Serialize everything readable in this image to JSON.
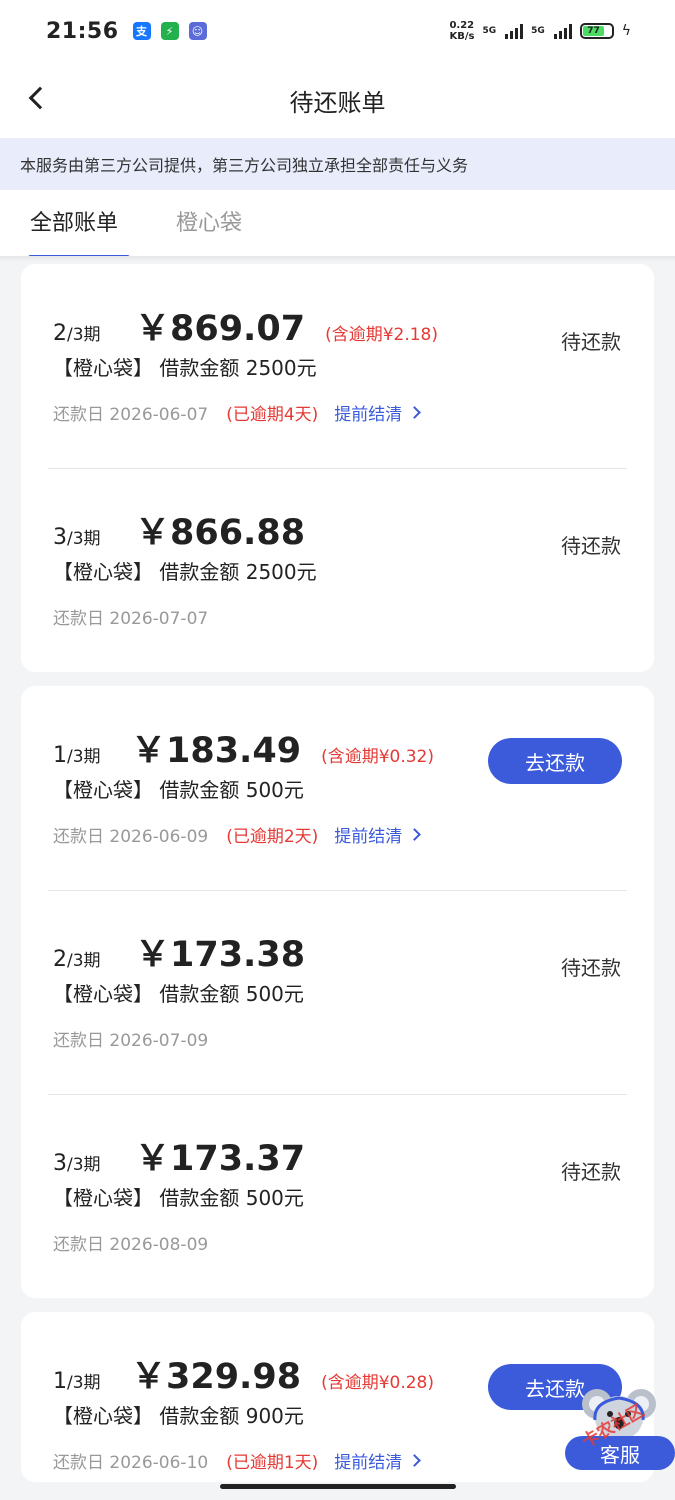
{
  "status_bar": {
    "time": "21:56",
    "network_speed": "0.22",
    "network_unit": "KB/s",
    "sim1": "5G",
    "sim2": "5G",
    "battery": "77"
  },
  "header": {
    "title": "待还账单",
    "back_icon": "chevron-left-icon"
  },
  "notice": "本服务由第三方公司提供，第三方公司独立承担全部责任与义务",
  "tabs": [
    {
      "label": "全部账单",
      "active": true
    },
    {
      "label": "橙心袋",
      "active": false
    }
  ],
  "labels": {
    "due_date_prefix": "还款日",
    "prepay": "提前结清",
    "pay_button": "去还款",
    "status_pending": "待还款"
  },
  "groups": [
    {
      "bills": [
        {
          "period_num": "2",
          "period_total": "/3期",
          "amount": "￥869.07",
          "overdue_amount": "(含逾期¥2.18)",
          "product_line": "【橙心袋】 借款金额 2500元",
          "due_date": "还款日 2026-06-07",
          "overdue_days": "(已逾期4天)",
          "prepay": "提前结清",
          "action": "待还款"
        },
        {
          "period_num": "3",
          "period_total": "/3期",
          "amount": "￥866.88",
          "overdue_amount": "",
          "product_line": "【橙心袋】 借款金额 2500元",
          "due_date": "还款日 2026-07-07",
          "overdue_days": "",
          "prepay": "",
          "action": "待还款"
        }
      ]
    },
    {
      "bills": [
        {
          "period_num": "1",
          "period_total": "/3期",
          "amount": "￥183.49",
          "overdue_amount": "(含逾期¥0.32)",
          "product_line": "【橙心袋】 借款金额 500元",
          "due_date": "还款日 2026-06-09",
          "overdue_days": "(已逾期2天)",
          "prepay": "提前结清",
          "action": "去还款"
        },
        {
          "period_num": "2",
          "period_total": "/3期",
          "amount": "￥173.38",
          "overdue_amount": "",
          "product_line": "【橙心袋】 借款金额 500元",
          "due_date": "还款日 2026-07-09",
          "overdue_days": "",
          "prepay": "",
          "action": "待还款"
        },
        {
          "period_num": "3",
          "period_total": "/3期",
          "amount": "￥173.37",
          "overdue_amount": "",
          "product_line": "【橙心袋】 借款金额 500元",
          "due_date": "还款日 2026-08-09",
          "overdue_days": "",
          "prepay": "",
          "action": "待还款"
        }
      ]
    },
    {
      "bills": [
        {
          "period_num": "1",
          "period_total": "/3期",
          "amount": "￥329.98",
          "overdue_amount": "(含逾期¥0.28)",
          "product_line": "【橙心袋】 借款金额 900元",
          "due_date": "还款日 2026-06-10",
          "overdue_days": "(已逾期1天)",
          "prepay": "提前结清",
          "action": "去还款"
        }
      ]
    }
  ],
  "floating_service": {
    "label": "客服",
    "icon": "koala-mascot-icon"
  },
  "watermark": "卡农社区",
  "colors": {
    "accent": "#3b5bdb",
    "danger": "#e53935",
    "notice_bg": "#e8ecfb"
  }
}
